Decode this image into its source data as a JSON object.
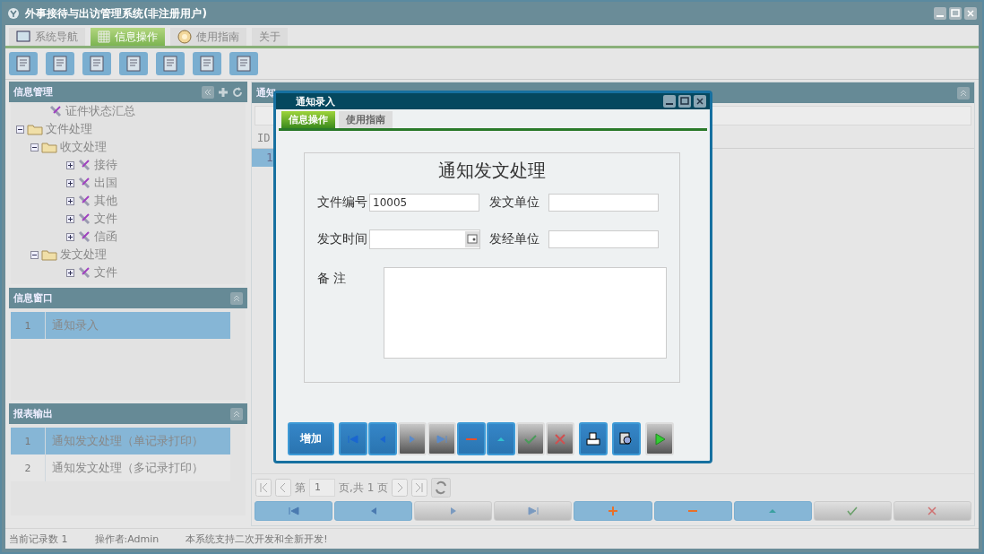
{
  "window": {
    "title": "外事接待与出访管理系统(非注册用户)"
  },
  "main_tabs": [
    {
      "label": "系统导航",
      "selected": false,
      "kind": "monitor"
    },
    {
      "label": "信息操作",
      "selected": true,
      "kind": "grid"
    },
    {
      "label": "使用指南",
      "selected": false,
      "kind": "help"
    },
    {
      "label": "关于",
      "selected": false,
      "kind": "none"
    }
  ],
  "info_management": {
    "title": "信息管理",
    "tree": [
      {
        "label": "证件状态汇总",
        "kind": "item"
      },
      {
        "label": "文件处理",
        "kind": "folder",
        "expanded": true,
        "children": [
          {
            "label": "收文处理",
            "kind": "folder",
            "expanded": true,
            "children": [
              {
                "label": "接待",
                "kind": "item",
                "expanded": false
              },
              {
                "label": "出国",
                "kind": "item",
                "expanded": false
              },
              {
                "label": "其他",
                "kind": "item",
                "expanded": false
              },
              {
                "label": "文件",
                "kind": "item",
                "expanded": false
              },
              {
                "label": "信函",
                "kind": "item",
                "expanded": false
              }
            ]
          },
          {
            "label": "发文处理",
            "kind": "folder",
            "expanded": true,
            "children": [
              {
                "label": "文件",
                "kind": "item",
                "expanded": false
              }
            ]
          }
        ]
      }
    ]
  },
  "info_window": {
    "title": "信息窗口",
    "rows": [
      {
        "index": "1",
        "label": "通知录入",
        "selected": true
      }
    ]
  },
  "report_output": {
    "title": "报表输出",
    "rows": [
      {
        "index": "1",
        "label": "通知发文处理（单记录打印）",
        "selected": true
      },
      {
        "index": "2",
        "label": "通知发文处理（多记录打印）",
        "selected": false
      }
    ]
  },
  "notice_panel": {
    "title": "通知",
    "grid": {
      "columns": [
        "ID"
      ],
      "rows": [
        {
          "id": "1",
          "selected": true
        }
      ]
    },
    "pager": {
      "page_prefix": "第",
      "page": "1",
      "page_suffix": "页,共 1 页"
    },
    "buttons": [
      {
        "kind": "first",
        "disabled": false
      },
      {
        "kind": "prev",
        "disabled": false
      },
      {
        "kind": "next",
        "disabled": true
      },
      {
        "kind": "last",
        "disabled": true
      },
      {
        "kind": "add",
        "disabled": false
      },
      {
        "kind": "remove",
        "disabled": false
      },
      {
        "kind": "up",
        "disabled": false
      },
      {
        "kind": "save",
        "disabled": true
      },
      {
        "kind": "cancel",
        "disabled": true
      }
    ]
  },
  "dialog": {
    "title": "通知录入",
    "tabs": [
      {
        "label": "信息操作",
        "selected": true
      },
      {
        "label": "使用指南",
        "selected": false
      }
    ],
    "heading": "通知发文处理",
    "fields": [
      {
        "label": "文件编号",
        "value": "10005",
        "kind": "text"
      },
      {
        "label": "发文单位",
        "kind": "text"
      },
      {
        "label": "发文时间",
        "kind": "date"
      },
      {
        "label": "发经单位",
        "kind": "text"
      }
    ],
    "remarks": {
      "label": "备 注"
    },
    "buttons": [
      {
        "kind": "add",
        "label": "增加",
        "disabled": false
      },
      {
        "kind": "first",
        "disabled": false
      },
      {
        "kind": "prev",
        "disabled": false
      },
      {
        "kind": "next",
        "disabled": true
      },
      {
        "kind": "last",
        "disabled": true
      },
      {
        "kind": "remove",
        "disabled": false
      },
      {
        "kind": "up",
        "disabled": false
      },
      {
        "kind": "save",
        "disabled": true
      },
      {
        "kind": "cancel",
        "disabled": true
      },
      {
        "kind": "print",
        "disabled": false
      },
      {
        "kind": "preview",
        "disabled": false
      },
      {
        "kind": "run",
        "disabled": true
      }
    ]
  },
  "status_bar": [
    "当前记录数 1",
    "操作者:Admin",
    "本系统支持二次开发和全新开发!"
  ]
}
